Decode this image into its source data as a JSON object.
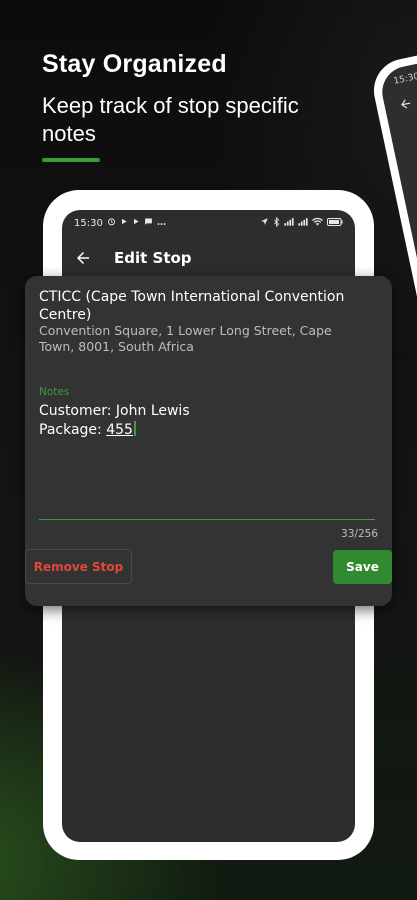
{
  "promo": {
    "headline": "Stay Organized",
    "subline": "Keep track of stop specific notes",
    "accent_color": "#3c9a3a"
  },
  "side_phone": {
    "status_time": "15:30",
    "back_icon": "back-arrow-icon",
    "time_fragment": "15"
  },
  "status_bar": {
    "time": "15:30",
    "left_icons": [
      "alarm-icon",
      "play-icon",
      "play-icon",
      "message-icon",
      "more-icon"
    ],
    "right_icons": [
      "navigation-icon",
      "bluetooth-icon",
      "signal-icon",
      "signal-icon",
      "wifi-icon",
      "battery-icon"
    ]
  },
  "app_bar": {
    "back_icon": "back-arrow-icon",
    "title": "Edit Stop"
  },
  "dialog": {
    "stop_name": "CTICC (Cape Town International Convention Centre)",
    "stop_address": "Convention Square, 1 Lower Long Street, Cape Town, 8001, South Africa",
    "notes_label": "Notes",
    "notes_line1": "Customer: John Lewis",
    "notes_line2_prefix": "Package: ",
    "notes_line2_value": "455",
    "char_counter": "33/256",
    "remove_label": "Remove Stop",
    "save_label": "Save",
    "colors": {
      "accent_green": "#3f9a3d",
      "danger_red": "#e0483a",
      "save_green": "#2f8a30"
    }
  }
}
